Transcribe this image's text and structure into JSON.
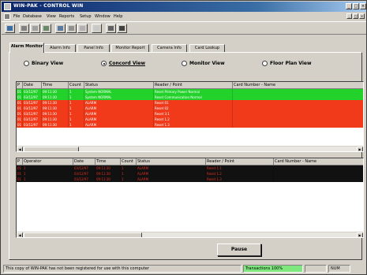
{
  "window": {
    "title": "WIN-PAK - CONTROL WIN"
  },
  "menu": [
    "File",
    "Database",
    "View",
    "Reports",
    "Setup",
    "Window",
    "Help"
  ],
  "tabs": [
    {
      "label": "Alarm Monitor",
      "active": true
    },
    {
      "label": "Alarm Info",
      "active": false
    },
    {
      "label": "Panel Info",
      "active": false
    },
    {
      "label": "Monitor Report",
      "active": false
    },
    {
      "label": "Camera Info",
      "active": false
    },
    {
      "label": "Card Lookup",
      "active": false
    }
  ],
  "views": [
    {
      "label": "Binary View",
      "selected": false
    },
    {
      "label": "Concord View",
      "selected": true
    },
    {
      "label": "Monitor View",
      "selected": false
    },
    {
      "label": "Floor Plan View",
      "selected": false
    }
  ],
  "alarm_grid": {
    "columns": [
      "P",
      "Date",
      "Time",
      "Count",
      "Status",
      "Reader / Point",
      "Card Number - Name"
    ],
    "rows": [
      {
        "color": "#22d22a",
        "cells": [
          "01",
          "03/12/97",
          "09:11:30",
          "1",
          "System NORMAL",
          "Reset Primary Power Normal",
          ""
        ]
      },
      {
        "color": "#22d22a",
        "cells": [
          "01",
          "03/12/97",
          "09:11:30",
          "1",
          "System NORMAL",
          "Reset Communication Normal",
          ""
        ]
      },
      {
        "color": "#f03a1a",
        "cells": [
          "01",
          "03/12/97",
          "09:11:30",
          "1",
          "ALARM",
          "Reset 01",
          ""
        ]
      },
      {
        "color": "#f03a1a",
        "cells": [
          "01",
          "03/12/97",
          "09:11:30",
          "1",
          "ALARM",
          "Reset 02",
          ""
        ]
      },
      {
        "color": "#f03a1a",
        "cells": [
          "01",
          "03/12/97",
          "09:11:30",
          "1",
          "ALARM",
          "Reset 3.1",
          ""
        ]
      },
      {
        "color": "#f03a1a",
        "cells": [
          "01",
          "03/12/97",
          "09:11:30",
          "1",
          "ALARM",
          "Reset 1.2",
          ""
        ]
      },
      {
        "color": "#f03a1a",
        "cells": [
          "01",
          "03/12/97",
          "09:11:30",
          "1",
          "ALARM",
          "Reset 1.3",
          ""
        ]
      }
    ]
  },
  "operator_grid": {
    "columns": [
      "P",
      "Operator",
      "Date",
      "Time",
      "Count",
      "Status",
      "Reader / Point",
      "Card Number - Name"
    ],
    "rows": [
      {
        "cells": [
          "01",
          "1",
          "03/12/97",
          "09:11:30",
          "1",
          "ALARM",
          "Reset 1.1",
          ""
        ]
      },
      {
        "cells": [
          "01",
          "1",
          "03/12/97",
          "09:11:30",
          "1",
          "ALARM",
          "Reset 1.2",
          ""
        ]
      },
      {
        "cells": [
          "01",
          "1",
          "03/12/97",
          "09:11:30",
          "1",
          "ALARM",
          "Reset 1.3",
          ""
        ]
      }
    ]
  },
  "buttons": {
    "pause": "Pause"
  },
  "status": {
    "message": "This copy of WIN-PAK has not been registered for use with this computer",
    "transactions": "Transactions 100%",
    "mode": "",
    "clock": "NUM"
  }
}
